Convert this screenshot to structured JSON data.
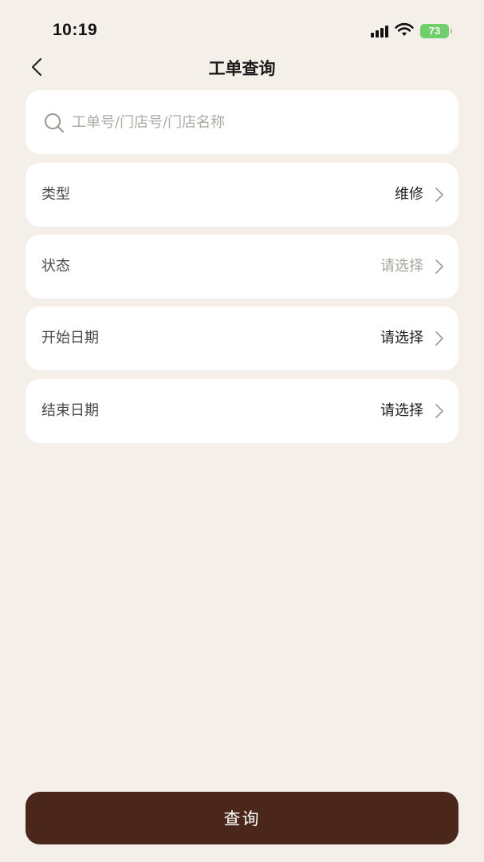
{
  "status_bar": {
    "time": "10:19",
    "battery": "73",
    "icons": [
      "signal-icon",
      "wifi-icon",
      "battery-icon"
    ]
  },
  "nav": {
    "title": "工单查询",
    "back_icon": "chevron-left-icon"
  },
  "search": {
    "placeholder": "工单号/门店号/门店名称",
    "value": "",
    "icon": "search-icon"
  },
  "filters": [
    {
      "label": "类型",
      "value": "维修"
    },
    {
      "label": "状态",
      "value": "请选择"
    },
    {
      "label": "开始日期",
      "value": "请选择"
    },
    {
      "label": "结束日期",
      "value": "请选择"
    }
  ],
  "submit": {
    "label": "查询"
  },
  "colors": {
    "background": "#F4EFE9",
    "card": "#FFFFFF",
    "primary_button": "#4B261A",
    "placeholder_text": "#A8A4A0",
    "battery": "#6FCF6A"
  }
}
